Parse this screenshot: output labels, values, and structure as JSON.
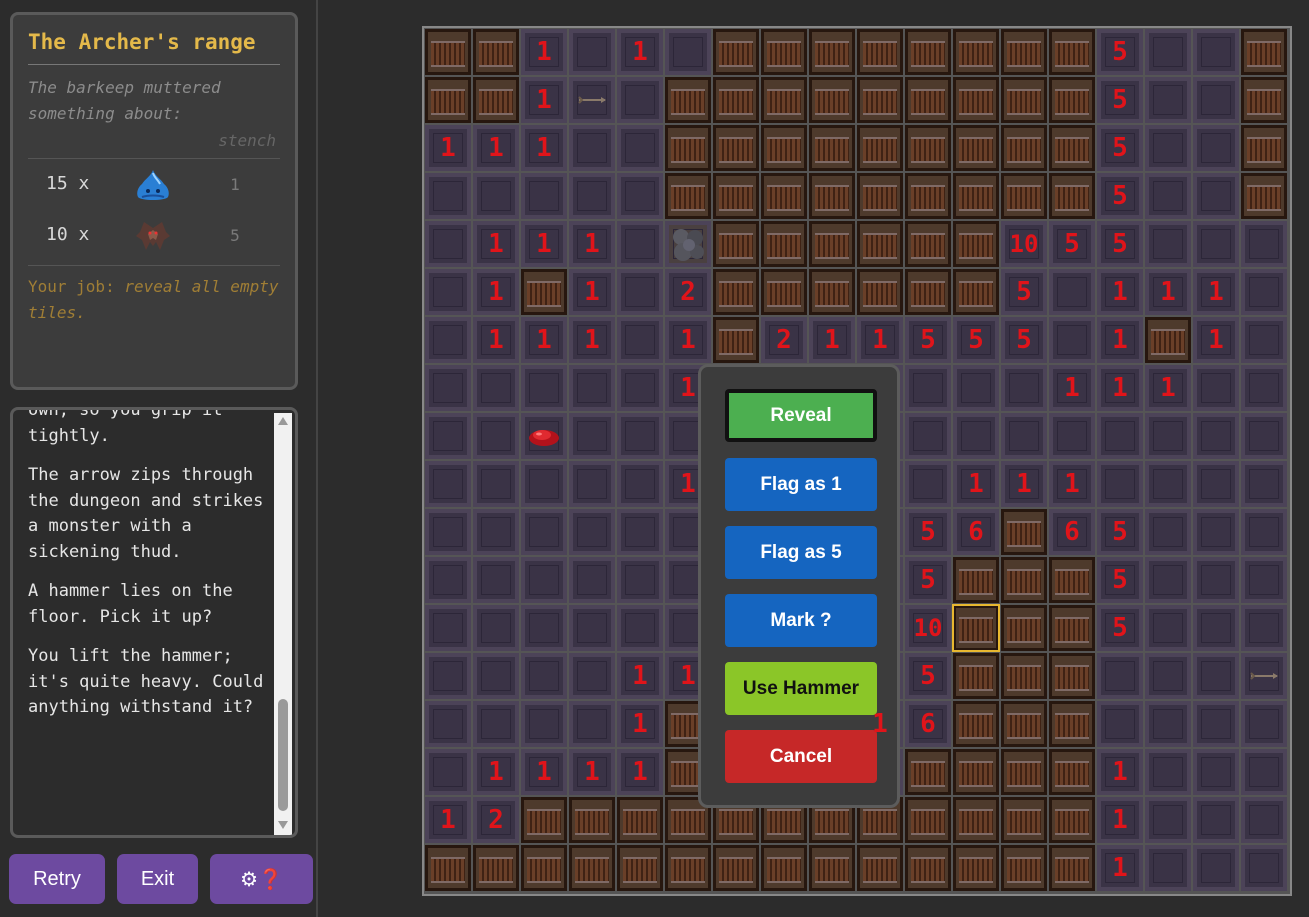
{
  "info": {
    "title": "The Archer's range",
    "rumor": "The barkeep muttered something about:",
    "hint": "stench",
    "monsters": [
      {
        "count": "15 x",
        "icon": "blue-slime-icon",
        "power": "1"
      },
      {
        "count": "10 x",
        "icon": "bat-icon",
        "power": "5"
      }
    ],
    "job_prefix": "Your job:",
    "job_task": "reveal all empty tiles."
  },
  "log": [
    "own, so you grip it tightly.",
    "The arrow zips through the dungeon and strikes a monster with a sickening thud.",
    "A hammer lies on the floor. Pick it up?",
    "You lift the hammer; it's quite heavy. Could anything withstand it?"
  ],
  "buttons": {
    "retry": "Retry",
    "exit": "Exit",
    "settings_icons": "⚙❓"
  },
  "board": {
    "cols": 18,
    "rows": 18,
    "selected": [
      12,
      11
    ],
    "grid": [
      "CC1.1.CCCCCCCC5..C",
      "CC1A.CCCCCCCCC5..C",
      "111..CCCCCCCCC5..C",
      ".....CCCCCCCCC5..C",
      ".111.RCCCCCC{55..."
    ]
  },
  "grid_rows": [
    "CC1.1.CCCCCCCC5..C",
    "CC1A.CCCCCCCCC5..C",
    "111..CCCCCCCCC5..C",
    ".....CCCCCCCCC5..C",
    ".111.RCCCCCCX55...",
    ".1C1.2CCCCCC5.111.",
    ".111.1C21155501C1.",
    ".....1.......111..",
    "..B...............",
    ".....1.....111....",
    "..........56C65...",
    "..........5CCC5...",
    "..........XCCC5...",
    "....11....5CCC...A",
    "....1C...16CCC....",
    ".1111C....CCCC1...",
    "12CCCCCCCCCCCC1...",
    "CCCCCCCCCCCCCC1..."
  ],
  "menu": {
    "reveal": "Reveal",
    "flag1": "Flag as 1",
    "flag5": "Flag as 5",
    "mark": "Mark ?",
    "hammer": "Use Hammer",
    "cancel": "Cancel"
  },
  "colors": {
    "reveal": "#4caf50",
    "flag": "#1565c0",
    "hammer": "#8bc628",
    "cancel": "#c62828",
    "side_button": "#6d4aa0",
    "number": "#e0141a"
  }
}
